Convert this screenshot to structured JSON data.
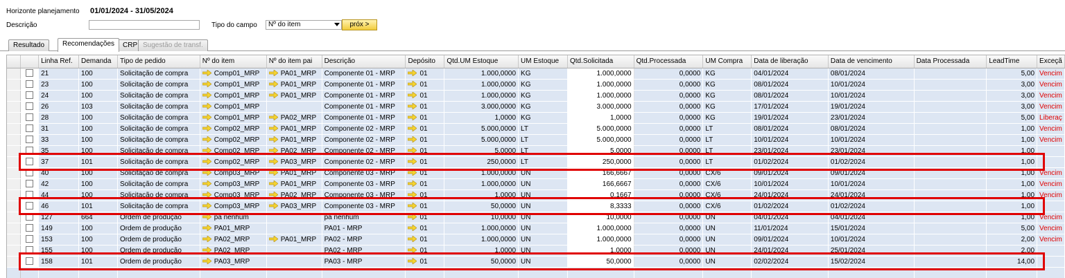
{
  "filters": {
    "horizon_label": "Horizonte planejamento",
    "horizon_value": "01/01/2024 - 31/05/2024",
    "description_label": "Descrição",
    "description_value": "",
    "field_type_label": "Tipo do campo",
    "field_type_value": "Nº do item",
    "next_button": "próx >"
  },
  "tabs": [
    {
      "label": "Resultado",
      "state": "normal"
    },
    {
      "label": "Recomendações",
      "state": "active"
    },
    {
      "label": "CRP",
      "state": "normal"
    },
    {
      "label": "Sugestão de transf.",
      "state": "disabled"
    }
  ],
  "columns": [
    "Linha Ref.",
    "Demanda",
    "Tipo de pedido",
    "Nº do item",
    "Nº do item pai",
    "Descrição",
    "Depósito",
    "Qtd.UM Estoque",
    "UM Estoque",
    "Qtd.Solicitada",
    "Qtd.Processada",
    "UM Compra",
    "Data de liberação",
    "Data de vencimento",
    "Data Processada",
    "LeadTime",
    "Exceçã"
  ],
  "rows": [
    {
      "ref": "21",
      "dem": "100",
      "tipo": "Solicitação de compra",
      "item": "Comp01_MRP",
      "pai": "PA01_MRP",
      "desc": "Componente 01 - MRP",
      "dep": "01",
      "qtdum": "1.000,0000",
      "um": "KG",
      "qtdsol": "1.000,0000",
      "qtdproc": "0,0000",
      "umc": "KG",
      "lib": "04/01/2024",
      "venc": "08/01/2024",
      "proc": "",
      "lead": "5,00",
      "exc": "Vencim"
    },
    {
      "ref": "23",
      "dem": "100",
      "tipo": "Solicitação de compra",
      "item": "Comp01_MRP",
      "pai": "PA01_MRP",
      "desc": "Componente 01 - MRP",
      "dep": "01",
      "qtdum": "1.000,0000",
      "um": "KG",
      "qtdsol": "1.000,0000",
      "qtdproc": "0,0000",
      "umc": "KG",
      "lib": "08/01/2024",
      "venc": "10/01/2024",
      "proc": "",
      "lead": "3,00",
      "exc": "Vencim"
    },
    {
      "ref": "24",
      "dem": "100",
      "tipo": "Solicitação de compra",
      "item": "Comp01_MRP",
      "pai": "PA01_MRP",
      "desc": "Componente 01 - MRP",
      "dep": "01",
      "qtdum": "1.000,0000",
      "um": "KG",
      "qtdsol": "1.000,0000",
      "qtdproc": "0,0000",
      "umc": "KG",
      "lib": "08/01/2024",
      "venc": "10/01/2024",
      "proc": "",
      "lead": "3,00",
      "exc": "Vencim"
    },
    {
      "ref": "26",
      "dem": "103",
      "tipo": "Solicitação de compra",
      "item": "Comp01_MRP",
      "pai": "",
      "desc": "Componente 01 - MRP",
      "dep": "01",
      "qtdum": "3.000,0000",
      "um": "KG",
      "qtdsol": "3.000,0000",
      "qtdproc": "0,0000",
      "umc": "KG",
      "lib": "17/01/2024",
      "venc": "19/01/2024",
      "proc": "",
      "lead": "3,00",
      "exc": "Vencim"
    },
    {
      "ref": "28",
      "dem": "100",
      "tipo": "Solicitação de compra",
      "item": "Comp01_MRP",
      "pai": "PA02_MRP",
      "desc": "Componente 01 - MRP",
      "dep": "01",
      "qtdum": "1,0000",
      "um": "KG",
      "qtdsol": "1,0000",
      "qtdproc": "0,0000",
      "umc": "KG",
      "lib": "19/01/2024",
      "venc": "23/01/2024",
      "proc": "",
      "lead": "5,00",
      "exc": "Liberaç"
    },
    {
      "ref": "31",
      "dem": "100",
      "tipo": "Solicitação de compra",
      "item": "Comp02_MRP",
      "pai": "PA01_MRP",
      "desc": "Componente 02 - MRP",
      "dep": "01",
      "qtdum": "5.000,0000",
      "um": "LT",
      "qtdsol": "5.000,0000",
      "qtdproc": "0,0000",
      "umc": "LT",
      "lib": "08/01/2024",
      "venc": "08/01/2024",
      "proc": "",
      "lead": "1,00",
      "exc": "Vencim"
    },
    {
      "ref": "33",
      "dem": "100",
      "tipo": "Solicitação de compra",
      "item": "Comp02_MRP",
      "pai": "PA01_MRP",
      "desc": "Componente 02 - MRP",
      "dep": "01",
      "qtdum": "5.000,0000",
      "um": "LT",
      "qtdsol": "5.000,0000",
      "qtdproc": "0,0000",
      "umc": "LT",
      "lib": "10/01/2024",
      "venc": "10/01/2024",
      "proc": "",
      "lead": "1,00",
      "exc": "Vencim"
    },
    {
      "ref": "35",
      "dem": "100",
      "tipo": "Solicitação de compra",
      "item": "Comp02_MRP",
      "pai": "PA02_MRP",
      "desc": "Componente 02 - MRP",
      "dep": "01",
      "qtdum": "5,0000",
      "um": "LT",
      "qtdsol": "5,0000",
      "qtdproc": "0,0000",
      "umc": "LT",
      "lib": "23/01/2024",
      "venc": "23/01/2024",
      "proc": "",
      "lead": "1,00",
      "exc": ""
    },
    {
      "ref": "37",
      "dem": "101",
      "tipo": "Solicitação de compra",
      "item": "Comp02_MRP",
      "pai": "PA03_MRP",
      "desc": "Componente 02 - MRP",
      "dep": "01",
      "qtdum": "250,0000",
      "um": "LT",
      "qtdsol": "250,0000",
      "qtdproc": "0,0000",
      "umc": "LT",
      "lib": "01/02/2024",
      "venc": "01/02/2024",
      "proc": "",
      "lead": "1,00",
      "exc": "",
      "highlight": true
    },
    {
      "ref": "40",
      "dem": "100",
      "tipo": "Solicitação de compra",
      "item": "Comp03_MRP",
      "pai": "PA01_MRP",
      "desc": "Componente 03 - MRP",
      "dep": "01",
      "qtdum": "1.000,0000",
      "um": "UN",
      "qtdsol": "166,6667",
      "qtdproc": "0,0000",
      "umc": "CX/6",
      "lib": "09/01/2024",
      "venc": "09/01/2024",
      "proc": "",
      "lead": "1,00",
      "exc": "Vencim"
    },
    {
      "ref": "42",
      "dem": "100",
      "tipo": "Solicitação de compra",
      "item": "Comp03_MRP",
      "pai": "PA01_MRP",
      "desc": "Componente 03 - MRP",
      "dep": "01",
      "qtdum": "1.000,0000",
      "um": "UN",
      "qtdsol": "166,6667",
      "qtdproc": "0,0000",
      "umc": "CX/6",
      "lib": "10/01/2024",
      "venc": "10/01/2024",
      "proc": "",
      "lead": "1,00",
      "exc": "Vencim"
    },
    {
      "ref": "44",
      "dem": "100",
      "tipo": "Solicitação de compra",
      "item": "Comp03_MRP",
      "pai": "PA02_MRP",
      "desc": "Componente 03 - MRP",
      "dep": "01",
      "qtdum": "1,0000",
      "um": "UN",
      "qtdsol": "0,1667",
      "qtdproc": "0,0000",
      "umc": "CX/6",
      "lib": "24/01/2024",
      "venc": "24/01/2024",
      "proc": "",
      "lead": "1,00",
      "exc": "Vencim"
    },
    {
      "ref": "46",
      "dem": "101",
      "tipo": "Solicitação de compra",
      "item": "Comp03_MRP",
      "pai": "PA03_MRP",
      "desc": "Componente 03 - MRP",
      "dep": "01",
      "qtdum": "50,0000",
      "um": "UN",
      "qtdsol": "8,3333",
      "qtdproc": "0,0000",
      "umc": "CX/6",
      "lib": "01/02/2024",
      "venc": "01/02/2024",
      "proc": "",
      "lead": "1,00",
      "exc": "",
      "highlight": true
    },
    {
      "ref": "127",
      "dem": "664",
      "tipo": "Ordem de produção",
      "item": "pa nenhum",
      "pai": "",
      "desc": "pa nenhum",
      "dep": "01",
      "qtdum": "10,0000",
      "um": "UN",
      "qtdsol": "10,0000",
      "qtdproc": "0,0000",
      "umc": "UN",
      "lib": "04/01/2024",
      "venc": "04/01/2024",
      "proc": "",
      "lead": "1,00",
      "exc": "Vencim"
    },
    {
      "ref": "149",
      "dem": "100",
      "tipo": "Ordem de produção",
      "item": "PA01_MRP",
      "pai": "",
      "desc": "PA01 - MRP",
      "dep": "01",
      "qtdum": "1.000,0000",
      "um": "UN",
      "qtdsol": "1.000,0000",
      "qtdproc": "0,0000",
      "umc": "UN",
      "lib": "11/01/2024",
      "venc": "15/01/2024",
      "proc": "",
      "lead": "5,00",
      "exc": "Vencim"
    },
    {
      "ref": "153",
      "dem": "100",
      "tipo": "Ordem de produção",
      "item": "PA02_MRP",
      "pai": "PA01_MRP",
      "desc": "PA02 - MRP",
      "dep": "01",
      "qtdum": "1.000,0000",
      "um": "UN",
      "qtdsol": "1.000,0000",
      "qtdproc": "0,0000",
      "umc": "UN",
      "lib": "09/01/2024",
      "venc": "10/01/2024",
      "proc": "",
      "lead": "2,00",
      "exc": "Vencim"
    },
    {
      "ref": "155",
      "dem": "100",
      "tipo": "Ordem de produção",
      "item": "PA02_MRP",
      "pai": "",
      "desc": "PA02 - MRP",
      "dep": "01",
      "qtdum": "1,0000",
      "um": "UN",
      "qtdsol": "1,0000",
      "qtdproc": "0,0000",
      "umc": "UN",
      "lib": "24/01/2024",
      "venc": "25/01/2024",
      "proc": "",
      "lead": "2,00",
      "exc": ""
    },
    {
      "ref": "158",
      "dem": "101",
      "tipo": "Ordem de produção",
      "item": "PA03_MRP",
      "pai": "",
      "desc": "PA03 - MRP",
      "dep": "01",
      "qtdum": "50,0000",
      "um": "UN",
      "qtdsol": "50,0000",
      "qtdproc": "0,0000",
      "umc": "UN",
      "lib": "02/02/2024",
      "venc": "15/02/2024",
      "proc": "",
      "lead": "14,00",
      "exc": "",
      "highlight": true
    }
  ],
  "colors": {
    "highlight_border": "#e00000",
    "row_fill": "#dde6f3",
    "exception_text": "#e00000",
    "arrow_fill": "#f5d431"
  }
}
